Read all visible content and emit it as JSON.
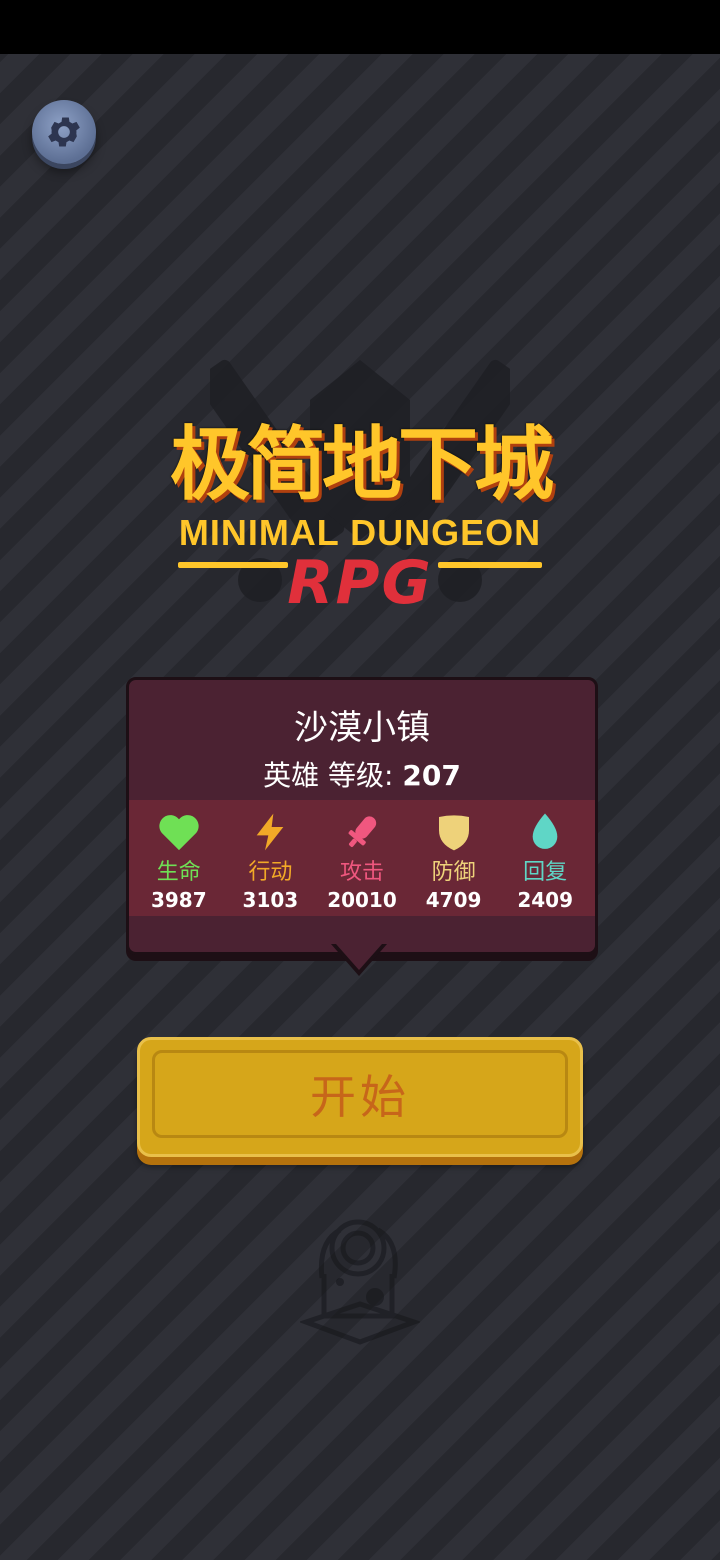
{
  "logo": {
    "cn_title": "极简地下城",
    "en_title": "MINIMAL DUNGEON",
    "rpg": "RPG"
  },
  "location": {
    "name": "沙漠小镇",
    "level_label": "英雄 等级:",
    "level_value": "207"
  },
  "stats": [
    {
      "label": "生命",
      "value": "3987",
      "color": "#6fe055",
      "icon": "heart-icon"
    },
    {
      "label": "行动",
      "value": "3103",
      "color": "#f2a927",
      "icon": "lightning-icon"
    },
    {
      "label": "攻击",
      "value": "20010",
      "color": "#f0577f",
      "icon": "sword-icon"
    },
    {
      "label": "防御",
      "value": "4709",
      "color": "#eed27a",
      "icon": "shield-icon"
    },
    {
      "label": "回复",
      "value": "2409",
      "color": "#5fd6c6",
      "icon": "droplet-icon"
    }
  ],
  "start_button": {
    "label": "开始"
  },
  "icons": {
    "settings": "gear-icon",
    "decoration": "creature-icon"
  }
}
